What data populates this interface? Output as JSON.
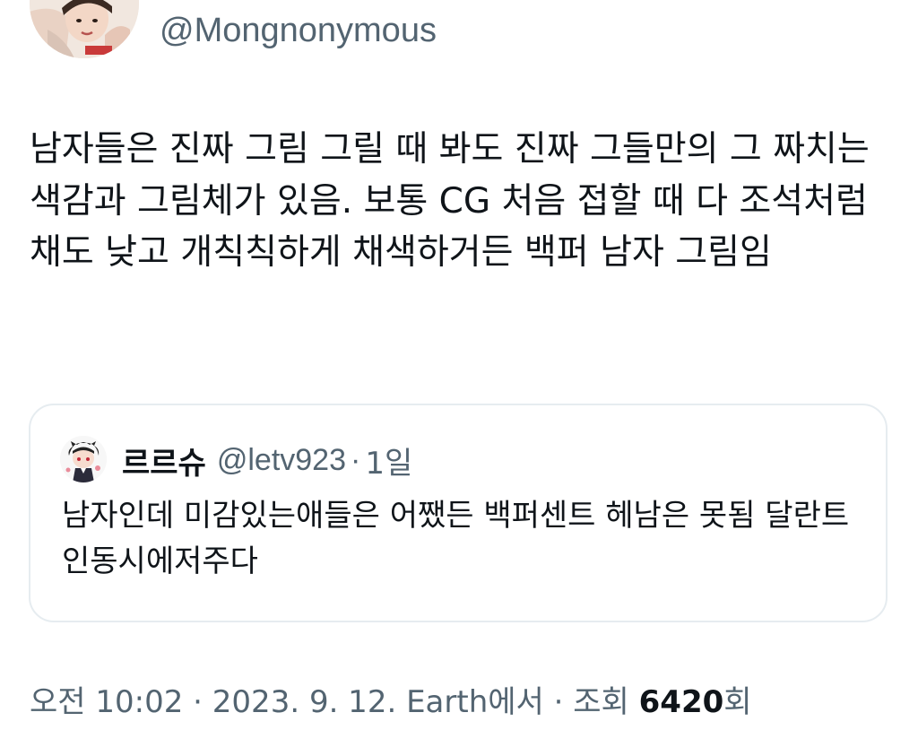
{
  "author": {
    "handle": "@Mongnonymous"
  },
  "tweet": {
    "text": "남자들은 진짜 그림 그릴 때 봐도 진짜 그들만의 그 짜치는 색감과 그림체가 있음. 보통 CG 처음 접할 때 다 조석처럼 채도 낮고 개칙칙하게 채색하거든 백퍼 남자 그림임"
  },
  "quote": {
    "name": "르르슈",
    "handle": "@letv923",
    "separator": "·",
    "time": "1일",
    "text": "남자인데 미감있는애들은 어쨌든 백퍼센트 헤남은 못됨 달란트인동시에저주다"
  },
  "meta": {
    "time": "오전 10:02",
    "separator1": "·",
    "date": "2023. 9. 12.",
    "source": "Earth에서",
    "separator2": "·",
    "views_label": "조회",
    "views_count": "6420",
    "views_suffix": "회"
  },
  "colors": {
    "text": "#0f1419",
    "muted": "#536471",
    "border": "#e6ecf0"
  },
  "icons": {
    "author_avatar": "user-photo-avatar",
    "quote_avatar": "cartoon-character-avatar"
  }
}
